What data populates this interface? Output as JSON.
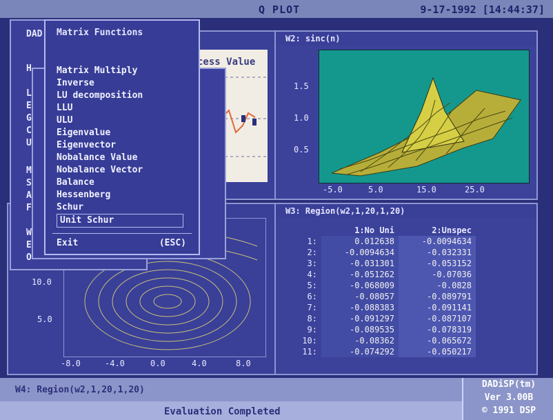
{
  "app": {
    "title": "Q PLOT",
    "datetime": "9-17-1992 [14:44:37]"
  },
  "windows": {
    "w1": {
      "title": "cess Value"
    },
    "w2": {
      "title": "W2: sinc(n)",
      "yticks": [
        "1.5",
        "1.0",
        "0.5"
      ],
      "xticks": [
        "-5.0",
        "5.0",
        "15.0",
        "25.0"
      ],
      "colors": {
        "plot_bg": "#14988e",
        "surface": "#c9c23b"
      }
    },
    "w3": {
      "title": "W3: Region(w2,1,20,1,20)",
      "columns": [
        "1:No Uni",
        "2:Unspec"
      ],
      "rows": [
        {
          "n": "1:",
          "a": "0.012638",
          "b": "-0.0094634"
        },
        {
          "n": "2:",
          "a": "-0.0094634",
          "b": "-0.032331"
        },
        {
          "n": "3:",
          "a": "-0.031301",
          "b": "-0.053152"
        },
        {
          "n": "4:",
          "a": "-0.051262",
          "b": "-0.07036"
        },
        {
          "n": "5:",
          "a": "-0.068009",
          "b": "-0.0828"
        },
        {
          "n": "6:",
          "a": "-0.08057",
          "b": "-0.089791"
        },
        {
          "n": "7:",
          "a": "-0.088383",
          "b": "-0.091141"
        },
        {
          "n": "8:",
          "a": "-0.091297",
          "b": "-0.087107"
        },
        {
          "n": "9:",
          "a": "-0.089535",
          "b": "-0.078319"
        },
        {
          "n": "10:",
          "a": "-0.08362",
          "b": "-0.065672"
        },
        {
          "n": "11:",
          "a": "-0.074292",
          "b": "-0.050217"
        }
      ]
    },
    "w4": {
      "yticks": [
        "10.0",
        "5.0"
      ],
      "xticks": [
        "-8.0",
        "-4.0",
        "0.0",
        "4.0",
        "8.0"
      ]
    }
  },
  "menus": {
    "back": {
      "title": "DAD",
      "letters": [
        "H",
        "L",
        "E",
        "G",
        "C",
        "U",
        "M",
        "S",
        "A",
        "F",
        "W",
        "E",
        "O"
      ]
    },
    "front": {
      "title": "Matrix Functions",
      "items": [
        "Matrix Multiply",
        "Inverse",
        "LU decomposition",
        "LLU",
        "ULU",
        "Eigenvalue",
        "Eigenvector",
        "Nobalance Value",
        "Nobalance Vector",
        "Balance",
        "Hessenberg",
        "Schur",
        "Unit Schur"
      ],
      "selected_index": 12,
      "exit_label": "Exit",
      "exit_key": "(ESC)"
    }
  },
  "cmdline": {
    "text": "W4: Region(w2,1,20,1,20)"
  },
  "status": {
    "text": "Evaluation Completed"
  },
  "brand": {
    "line1": "DADiSP(tm)",
    "line2": "Ver 3.00B",
    "line3": "© 1991 DSP"
  }
}
